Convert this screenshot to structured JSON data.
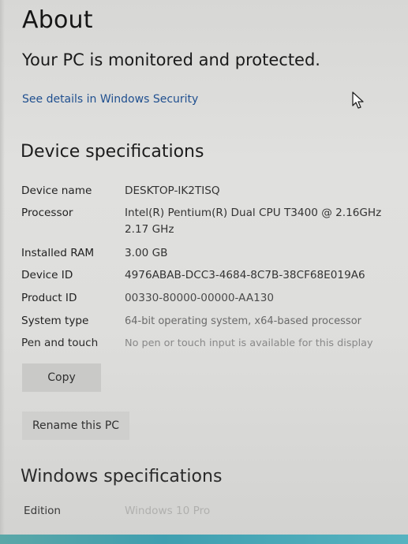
{
  "page": {
    "title": "About"
  },
  "protection": {
    "status": "Your PC is monitored and protected.",
    "link": "See details in Windows Security"
  },
  "device_specs": {
    "heading": "Device specifications",
    "rows": [
      {
        "label": "Device name",
        "value": "DESKTOP-IK2TISQ"
      },
      {
        "label": "Processor",
        "value": "Intel(R) Pentium(R) Dual  CPU  T3400  @ 2.16GHz",
        "value2": "2.17 GHz"
      },
      {
        "label": "Installed RAM",
        "value": "3.00 GB"
      },
      {
        "label": "Device ID",
        "value": "4976ABAB-DCC3-4684-8C7B-38CF68E019A6"
      },
      {
        "label": "Product ID",
        "value": "00330-80000-00000-AA130"
      },
      {
        "label": "System type",
        "value": "64-bit operating system, x64-based processor"
      },
      {
        "label": "Pen and touch",
        "value": "No pen or touch input is available for this display"
      }
    ]
  },
  "buttons": {
    "copy": "Copy",
    "rename": "Rename this PC"
  },
  "windows_specs": {
    "heading": "Windows specifications",
    "edition_label": "Edition",
    "edition_value": "Windows 10 Pro"
  },
  "icons": {
    "cursor": "mouse-pointer-icon"
  }
}
